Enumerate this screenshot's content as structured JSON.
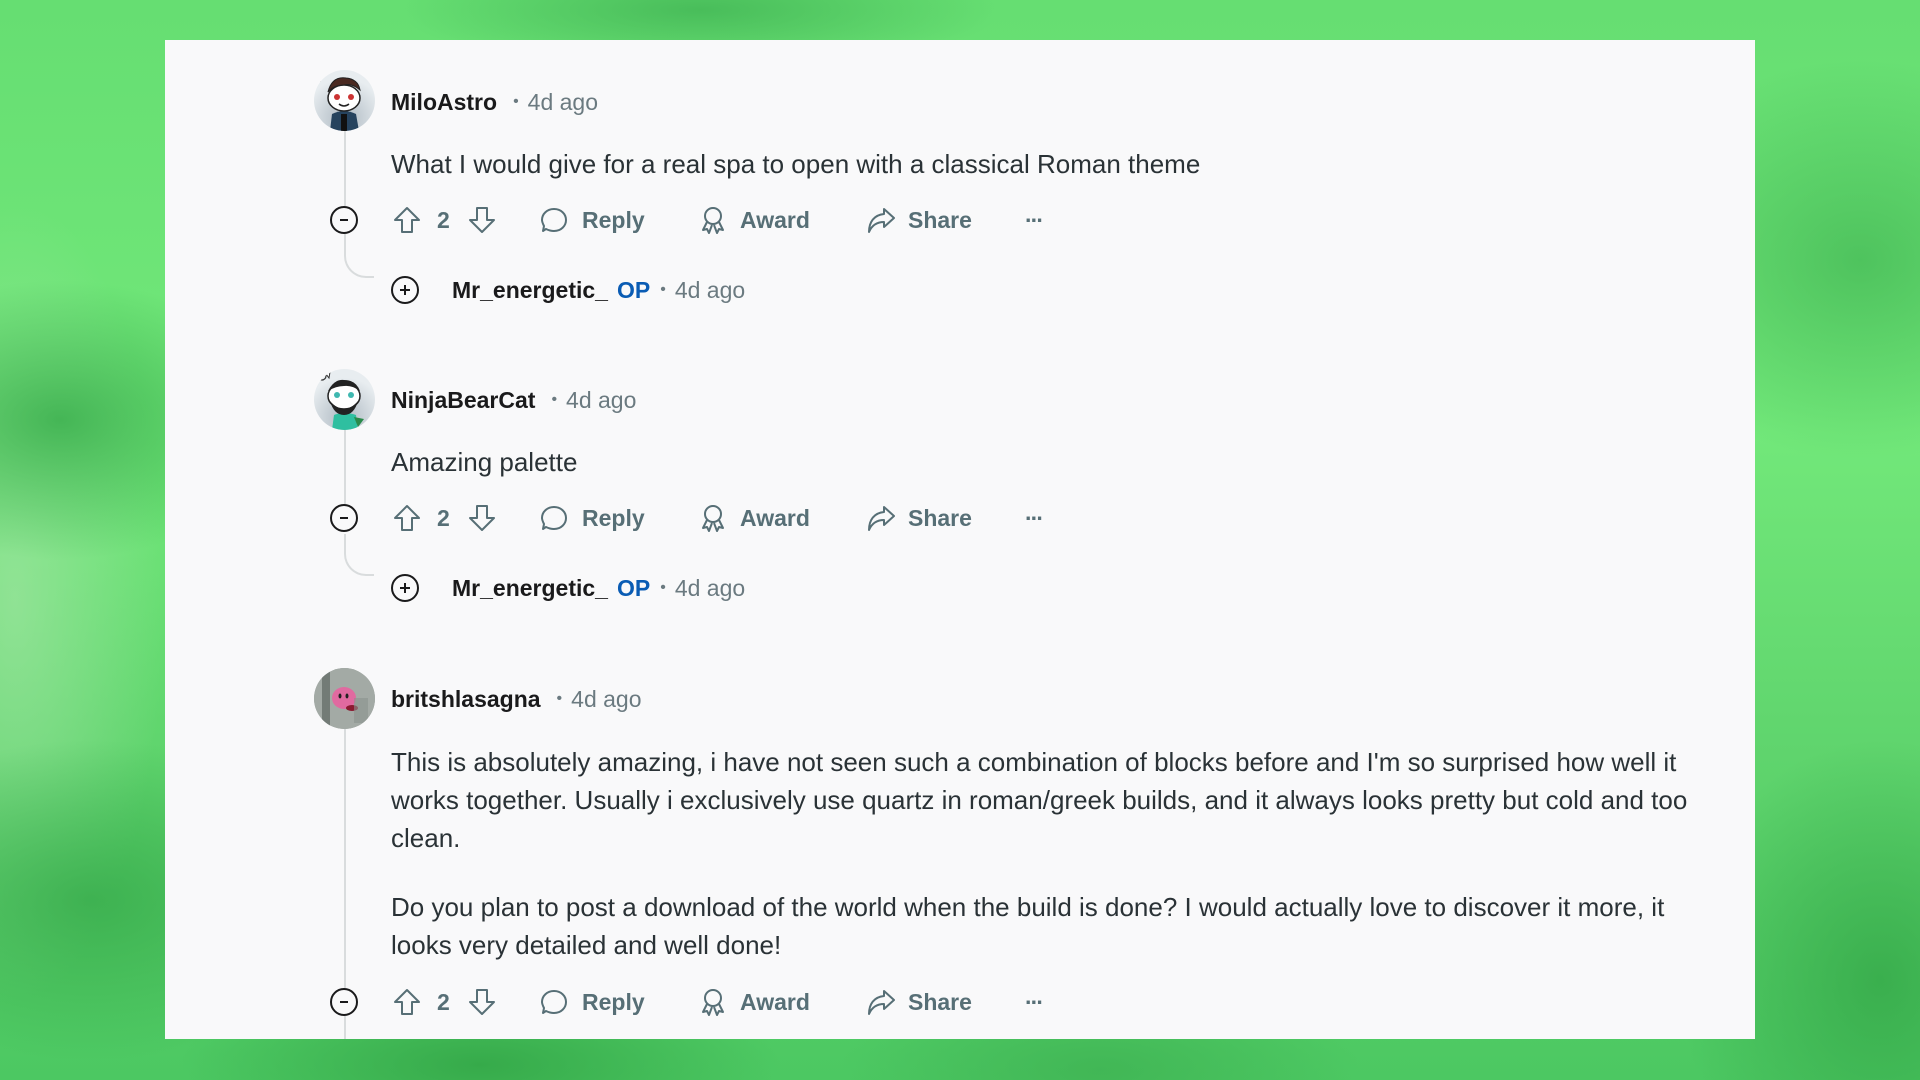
{
  "colors": {
    "panel_bg": "#f9f9fa",
    "username": "#1a1a1b",
    "timestamp": "#6b7a80",
    "body_text": "#2a3236",
    "action_text": "#576f76",
    "op_badge": "#0a5cb4",
    "thread_line": "#d9dcdd",
    "background_green": "#72e87a"
  },
  "comments": [
    {
      "username": "MiloAstro",
      "separator": "•",
      "time": "4d ago",
      "avatar_icon": "snoo-avatar-brown-hair",
      "paragraphs": [
        "What I would give for a real spa to open with a classical Roman theme"
      ],
      "actions": {
        "collapse_icon": "minus-circle-icon",
        "upvote_icon": "arrow-up-icon",
        "score": "2",
        "downvote_icon": "arrow-down-icon",
        "reply_label": "Reply",
        "award_label": "Award",
        "share_label": "Share",
        "more_label": "···"
      },
      "reply": {
        "expand_icon": "plus-circle-icon",
        "username": "Mr_energetic_",
        "badge": "OP",
        "separator": "•",
        "time": "4d ago"
      }
    },
    {
      "username": "NinjaBearCat",
      "separator": "•",
      "time": "4d ago",
      "avatar_icon": "snoo-avatar-bearded",
      "paragraphs": [
        "Amazing palette"
      ],
      "actions": {
        "collapse_icon": "minus-circle-icon",
        "upvote_icon": "arrow-up-icon",
        "score": "2",
        "downvote_icon": "arrow-down-icon",
        "reply_label": "Reply",
        "award_label": "Award",
        "share_label": "Share",
        "more_label": "···"
      },
      "reply": {
        "expand_icon": "plus-circle-icon",
        "username": "Mr_energetic_",
        "badge": "OP",
        "separator": "•",
        "time": "4d ago"
      }
    },
    {
      "username": "britshlasagna",
      "separator": "•",
      "time": "4d ago",
      "avatar_icon": "photo-avatar-pink-plush",
      "paragraphs": [
        "This is absolutely amazing, i have not seen such a combination of blocks before and I'm so surprised how well it works together. Usually i exclusively use quartz in roman/greek builds, and it always looks pretty but cold and too clean.",
        "Do you plan to post a download of the world when the build is done? I would actually love to discover it more, it looks very detailed and well done!"
      ],
      "actions": {
        "collapse_icon": "minus-circle-icon",
        "upvote_icon": "arrow-up-icon",
        "score": "2",
        "downvote_icon": "arrow-down-icon",
        "reply_label": "Reply",
        "award_label": "Award",
        "share_label": "Share",
        "more_label": "···"
      }
    }
  ]
}
